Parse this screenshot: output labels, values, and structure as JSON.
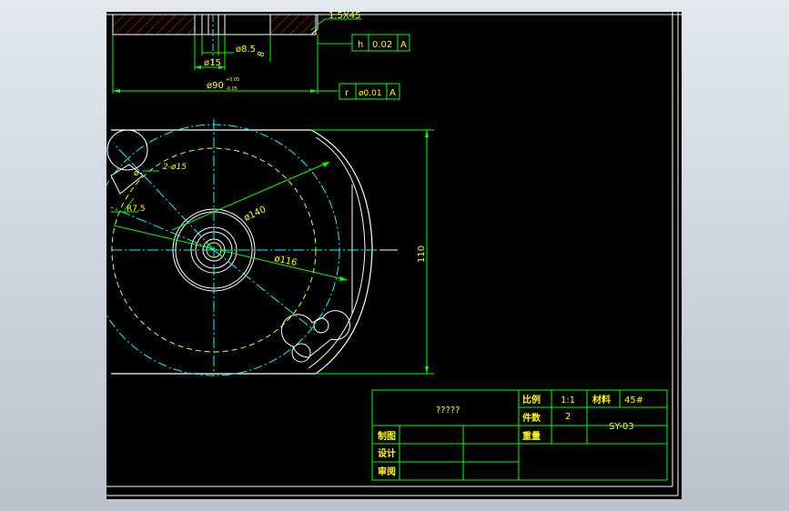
{
  "colors": {
    "background": "#000000",
    "frame": "#ffffff",
    "dimension": "#00ff00",
    "centerline": "#00ffff",
    "dashed": "#ffff00",
    "text": "#ffff00",
    "hatch": "#ff0000"
  },
  "dims": {
    "chamfer": "1.5X45",
    "d85": "ø8.5",
    "d15": "ø15",
    "depth8": "8",
    "d90": "ø90",
    "d90_tol_up": "+0.05",
    "d90_tol_down": "-0.05",
    "d140": "ø140",
    "d116": "ø116",
    "r75": "R7.5",
    "h110": "110",
    "holes": "2-ø15",
    "angle": "ø"
  },
  "tolerances": [
    {
      "symbol": "h",
      "value": "0.02",
      "datum": "A"
    },
    {
      "symbol": "r",
      "value": "ø0.01",
      "datum": "A"
    }
  ],
  "title_block": {
    "name": "?????",
    "scale_label": "比例",
    "scale_value": "1:1",
    "material_label": "材料",
    "material_value": "45#",
    "qty_label": "件数",
    "qty_value": "2",
    "drawing_no": "SY-03",
    "weight_label": "重量",
    "drawn_label": "制图",
    "design_label": "设计",
    "check_label": "审阅"
  }
}
